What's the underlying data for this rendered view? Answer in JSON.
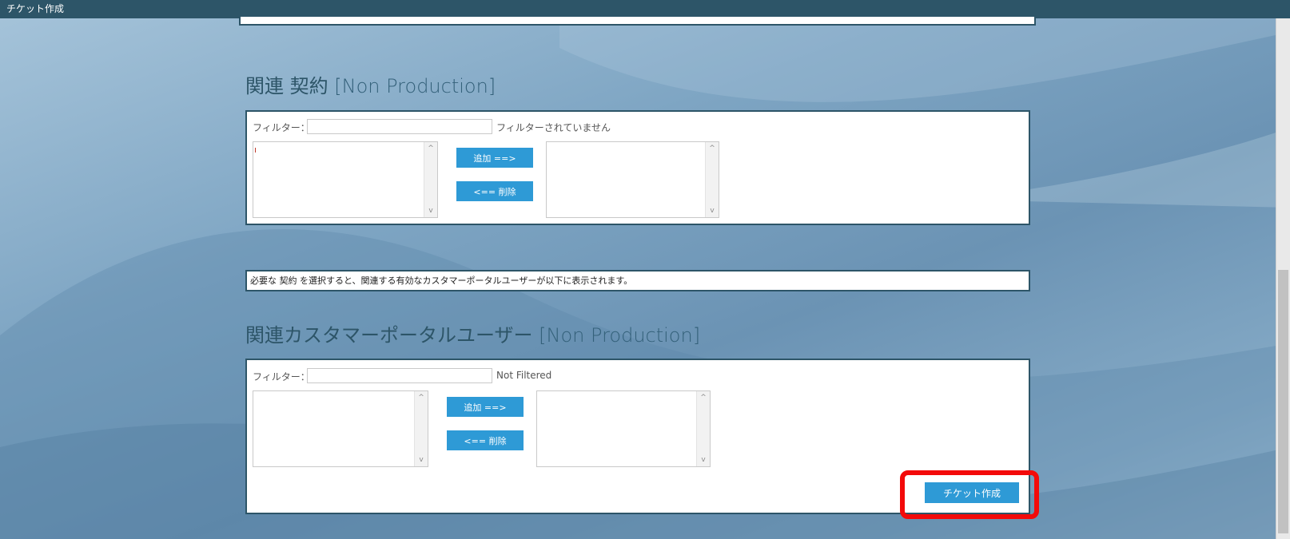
{
  "window": {
    "title": "チケット作成"
  },
  "contracts": {
    "heading": "関連 契約",
    "environment": "[Non Production]",
    "filter_label": "フィルター：",
    "filter_value": "",
    "filter_status": "フィルターされていません",
    "add_label": "追加 ==>",
    "remove_label": "<== 削除"
  },
  "info_text": "必要な 契約 を選択すると、関連する有効なカスタマーポータルユーザーが以下に表示されます。",
  "portal_users": {
    "heading": "関連カスタマーポータルユーザー",
    "environment": "[Non Production]",
    "filter_label": "フィルター：",
    "filter_value": "",
    "filter_status": "Not Filtered",
    "add_label": "追加 ==>",
    "remove_label": "<== 削除"
  },
  "submit_label": "チケット作成",
  "icons": {
    "scroll_up": "chevron-up-icon",
    "scroll_down": "chevron-down-icon"
  },
  "colors": {
    "header": "#2d5568",
    "button": "#2e9ad6",
    "highlight": "#f30a0a"
  }
}
